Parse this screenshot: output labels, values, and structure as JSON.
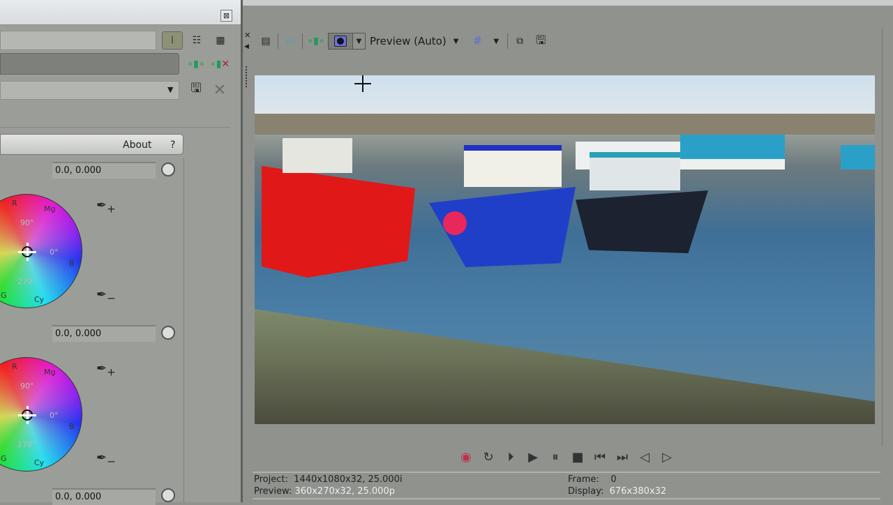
{
  "left_panel": {
    "about_label": "About",
    "help_label": "?",
    "wheels": [
      {
        "value": "0.0, 0.000",
        "labels": {
          "r": "R",
          "mg": "Mg",
          "b": "B",
          "cy": "Cy",
          "g": "G",
          "deg90": "90°",
          "deg0": "0°",
          "deg270": "270°"
        }
      },
      {
        "value": "0.0, 0.000",
        "labels": {
          "r": "R",
          "mg": "Mg",
          "b": "B",
          "cy": "Cy",
          "g": "G",
          "deg90": "90°",
          "deg0": "0°",
          "deg270": "270°"
        }
      },
      {
        "value": "0.0, 0.000"
      }
    ]
  },
  "preview": {
    "quality_label": "Preview (Auto)",
    "status": {
      "project_label": "Project:",
      "project_value": "1440x1080x32, 25.000i",
      "preview_label": "Preview:",
      "preview_value": "360x270x32, 25.000p",
      "frame_label": "Frame:",
      "frame_value": "0",
      "display_label": "Display:",
      "display_value": "676x380x32"
    }
  },
  "colors": {
    "record": "#c0304a",
    "accent_green": "#2a9a5a",
    "grid": "#6a6ad8"
  }
}
